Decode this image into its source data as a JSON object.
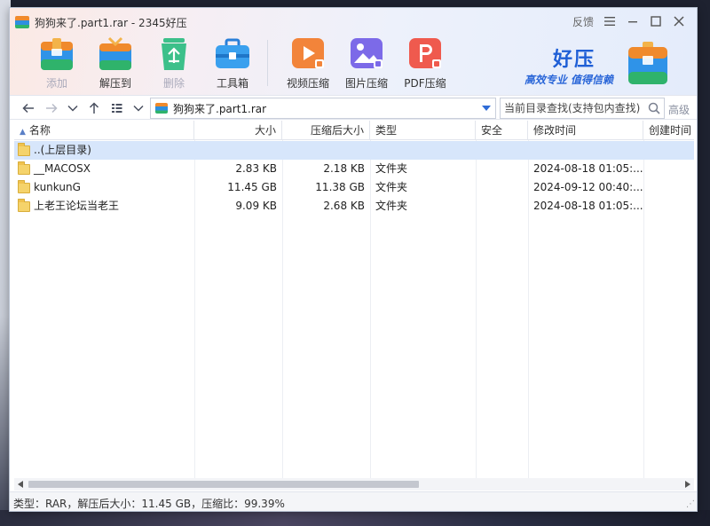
{
  "window": {
    "title": "狗狗来了.part1.rar - 2345好压",
    "feedback_label": "反馈"
  },
  "toolbar": {
    "items": [
      {
        "label": "添加",
        "icon": "add-archive-icon",
        "disabled": true
      },
      {
        "label": "解压到",
        "icon": "extract-to-icon",
        "disabled": false
      },
      {
        "label": "删除",
        "icon": "delete-recycle-icon",
        "disabled": true
      },
      {
        "label": "工具箱",
        "icon": "toolbox-icon",
        "disabled": false
      },
      {
        "label": "视频压缩",
        "icon": "video-compress-icon",
        "disabled": false
      },
      {
        "label": "图片压缩",
        "icon": "image-compress-icon",
        "disabled": false
      },
      {
        "label": "PDF压缩",
        "icon": "pdf-compress-icon",
        "disabled": false
      }
    ]
  },
  "brand": {
    "name": "好压",
    "slogan": "高效专业  值得信赖"
  },
  "nav": {
    "path": "狗狗来了.part1.rar",
    "search_placeholder": "当前目录查找(支持包内查找)",
    "advanced_label": "高级"
  },
  "columns": [
    "名称",
    "大小",
    "压缩后大小",
    "类型",
    "安全",
    "修改时间",
    "创建时间"
  ],
  "rows": [
    {
      "name": "..(上层目录)",
      "size": "",
      "packed": "",
      "type": "",
      "security": "",
      "modified": "",
      "created": "",
      "selected": true
    },
    {
      "name": "__MACOSX",
      "size": "2.83 KB",
      "packed": "2.18 KB",
      "type": "文件夹",
      "security": "",
      "modified": "2024-08-18 01:05:...",
      "created": "",
      "selected": false
    },
    {
      "name": "kunkunG",
      "size": "11.45 GB",
      "packed": "11.38 GB",
      "type": "文件夹",
      "security": "",
      "modified": "2024-09-12 00:40:...",
      "created": "",
      "selected": false
    },
    {
      "name": "上老王论坛当老王",
      "size": "9.09 KB",
      "packed": "2.68 KB",
      "type": "文件夹",
      "security": "",
      "modified": "2024-08-18 01:05:...",
      "created": "",
      "selected": false
    }
  ],
  "status": {
    "text": "类型：RAR，解压后大小：11.45 GB，压缩比：99.39%"
  },
  "colors": {
    "accent": "#2e6bd6",
    "selected_row": "#d7e6fb",
    "brand_blue": "#1f5fd6"
  }
}
